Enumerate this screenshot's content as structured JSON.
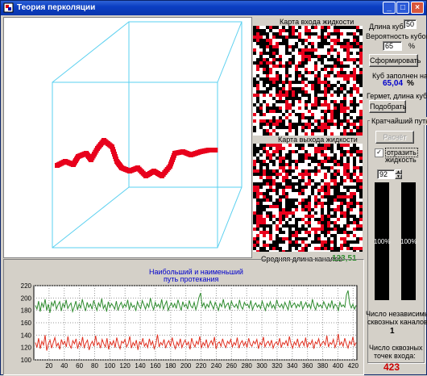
{
  "window": {
    "title": "Теория перколяции",
    "minimize": "_",
    "maximize": "□",
    "close": "×"
  },
  "inputs_map": {
    "title": "Карта входа жидкости"
  },
  "outputs_map": {
    "title": "Карта выхода жидкости"
  },
  "avg_length": {
    "label": "Средняя длина каналов",
    "value": "123,51"
  },
  "controls": {
    "cube_length_label": "Длина куба",
    "cube_length_value": "50",
    "prob_label": "Вероятность кубов",
    "prob_value": "65",
    "prob_unit": "%",
    "form_button": "Сформировать",
    "filled_label": "Куб заполнен на:",
    "filled_value": "65,04",
    "filled_unit": "%",
    "germet_label": "Гермет, длина куба",
    "pick_button": "Подобрать",
    "shortest_group": "Кратчайший путь",
    "calc_button": "Расчёт",
    "show_liquid_checked": "✓",
    "show_liquid_label1": "отразить",
    "show_liquid_label2": "жидкость",
    "spin_value": "92",
    "bar_left_label": "100%",
    "bar_right_label": "100%"
  },
  "stats": {
    "indep_label1": "Число независимых",
    "indep_label2": "сквозных каналов:",
    "indep_value": "1",
    "points_label1": "Число сквозных",
    "points_label2": "точек входа:",
    "points_value": "423"
  },
  "colors": {
    "path": "#e8001c",
    "green_series": "#2e8b2e",
    "red_series": "#e03020",
    "cube_edges": "#5ad0f0",
    "accent_blue": "#0000cc"
  },
  "chart_data": {
    "type": "line",
    "title_line1": "Наибольший и наименьший",
    "title_line2": "путь протекания",
    "xlim": [
      0,
      425
    ],
    "ylim": [
      100,
      220
    ],
    "x_ticks": [
      20,
      40,
      60,
      80,
      100,
      120,
      140,
      160,
      180,
      200,
      220,
      240,
      260,
      280,
      300,
      320,
      340,
      360,
      380,
      400,
      420
    ],
    "y_ticks": [
      100,
      120,
      140,
      160,
      180,
      200,
      220
    ],
    "grid": true,
    "series": [
      {
        "color": "#2e8b2e",
        "values": [
          188,
          182,
          195,
          178,
          192,
          185,
          198,
          180,
          190,
          176,
          193,
          187,
          196,
          182,
          189,
          194,
          179,
          191,
          185,
          197,
          183,
          188,
          192,
          178,
          186,
          195,
          181,
          190,
          184,
          198,
          187,
          179,
          193,
          185,
          190,
          182,
          196,
          188,
          180,
          192,
          186,
          199,
          183,
          189,
          178,
          194,
          185,
          191,
          187,
          182,
          195,
          180,
          188,
          193,
          184,
          190,
          186,
          197,
          181,
          192,
          185,
          188,
          179,
          194,
          187,
          183,
          196,
          189,
          182,
          191,
          185,
          200,
          188,
          181,
          193,
          186,
          190,
          184,
          198,
          182,
          189,
          195,
          180,
          187,
          192,
          185,
          191,
          183,
          197,
          188,
          180,
          194,
          186,
          190,
          182,
          196,
          187,
          184,
          193,
          181,
          189,
          201,
          208,
          186,
          192,
          183,
          190,
          185,
          195,
          188,
          182,
          193,
          187,
          180,
          191,
          186,
          198,
          184,
          189,
          192,
          181,
          195,
          188,
          185,
          190,
          183,
          197,
          186,
          182,
          193,
          188,
          190,
          184,
          196,
          181,
          188,
          192,
          185,
          189,
          183,
          195,
          187,
          180,
          191,
          186,
          194,
          184,
          189,
          182,
          197,
          188,
          185,
          190,
          183,
          193,
          187,
          181,
          196,
          185,
          189,
          192,
          184,
          190,
          186,
          195,
          182,
          188,
          193,
          185,
          190,
          183,
          198,
          187,
          181,
          192,
          186,
          189,
          184,
          194,
          188,
          182,
          191,
          185,
          196,
          183,
          190,
          187,
          180,
          193,
          186,
          189,
          185,
          205,
          212,
          191,
          184,
          190,
          182,
          188
        ]
      },
      {
        "color": "#e03020",
        "values": [
          128,
          120,
          135,
          118,
          130,
          124,
          140,
          115,
          126,
          132,
          119,
          128,
          136,
          122,
          127,
          117,
          133,
          125,
          130,
          121,
          138,
          124,
          119,
          131,
          126,
          134,
          118,
          129,
          123,
          137,
          120,
          127,
          132,
          116,
          125,
          130,
          122,
          139,
          124,
          128,
          119,
          133,
          126,
          121,
          135,
          117,
          129,
          124,
          131,
          120,
          136,
          125,
          118,
          130,
          127,
          133,
          121,
          126,
          138,
          119,
          128,
          123,
          132,
          116,
          129,
          125,
          135,
          122,
          127,
          120,
          134,
          124,
          130,
          118,
          126,
          141,
          121,
          128,
          124,
          133,
          119,
          127,
          131,
          122,
          136,
          125,
          118,
          129,
          123,
          134,
          120,
          127,
          132,
          124,
          129,
          117,
          135,
          126,
          121,
          130,
          125,
          138,
          119,
          128,
          123,
          133,
          120,
          126,
          131,
          124,
          137,
          118,
          127,
          129,
          122,
          134,
          125,
          120,
          130,
          126,
          133,
          121,
          128,
          124,
          136,
          119,
          127,
          131,
          123,
          129,
          120,
          135,
          125,
          122,
          130,
          126,
          133,
          118,
          128,
          124,
          137,
          121,
          127,
          130,
          123,
          132,
          119,
          126,
          129,
          124,
          135,
          120,
          128,
          125,
          131,
          122,
          138,
          126,
          119,
          129,
          124,
          134,
          121,
          127,
          130,
          123,
          136,
          120,
          128,
          125,
          132,
          118,
          129,
          126,
          134,
          122,
          127,
          130,
          124,
          139,
          121,
          128,
          125,
          133,
          120,
          127,
          142,
          124,
          129,
          122,
          135,
          126,
          119,
          130,
          125,
          137,
          123,
          128
        ]
      }
    ]
  }
}
